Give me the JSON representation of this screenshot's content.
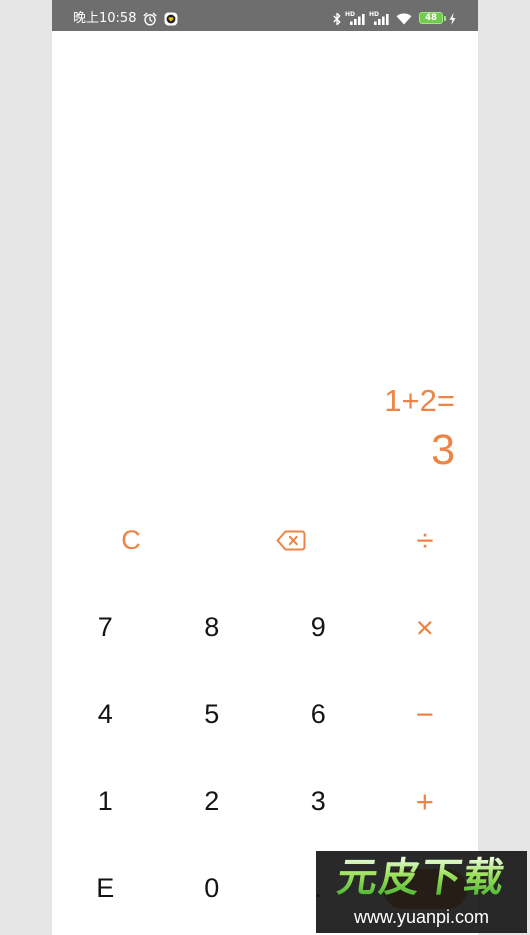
{
  "status_bar": {
    "time": "晚上10:58",
    "signal_label": "HD",
    "battery_level": "48",
    "left_icons": [
      "alarm-clock-icon",
      "app-notification-icon"
    ],
    "right_icons": [
      "bluetooth-icon",
      "signal-hd-icon",
      "signal-hd-icon",
      "wifi-icon",
      "battery-icon",
      "charging-bolt-icon"
    ]
  },
  "display": {
    "expression": "1+2=",
    "result": "3"
  },
  "keypad": {
    "top_row": [
      {
        "label": "C"
      },
      {
        "icon": "backspace-icon"
      },
      {
        "label": "÷"
      }
    ],
    "rows": [
      [
        "7",
        "8",
        "9",
        "×"
      ],
      [
        "4",
        "5",
        "6",
        "−"
      ],
      [
        "1",
        "2",
        "3",
        "+"
      ],
      [
        "E",
        "0",
        "."
      ]
    ]
  },
  "colors": {
    "accent": "#eb8446",
    "digit_text": "#141414",
    "status_bar": "#6e6e6e",
    "screen": "#ffffff",
    "outer_background": "#e6e6e6",
    "battery": "#74c94f"
  },
  "watermark": {
    "logo_text": "元皮下载",
    "url": "www.yuanpi.com"
  }
}
